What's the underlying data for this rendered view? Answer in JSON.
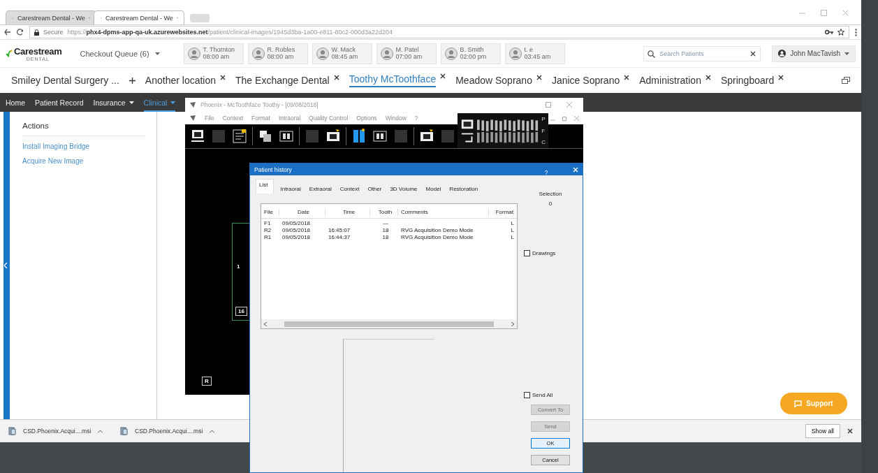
{
  "browser": {
    "tabs": [
      {
        "title": "Carestream Dental - We",
        "selected": false
      },
      {
        "title": "Carestream Dental - We",
        "selected": true
      }
    ],
    "secure_label": "Secure",
    "url": "https://**phx4-dpms-app-qa-uk.azurewebsites.net**/patient/clinical-images/1945d3ba-1a00-e811-80c2-000d3a22d204"
  },
  "header": {
    "logo": "Carestream",
    "logo_sub": "DENTAL",
    "queue": "Checkout Queue (6)",
    "appointments": [
      {
        "name": "T. Thornton",
        "time": "08:00 am"
      },
      {
        "name": "R. Robles",
        "time": "08:00 am"
      },
      {
        "name": "W. Mack",
        "time": "08:45 am"
      },
      {
        "name": "M. Patel",
        "time": "07:00 am"
      },
      {
        "name": "B. Smith",
        "time": "02:00 pm"
      },
      {
        "name": "t. e",
        "time": "03:45 am"
      }
    ],
    "search": {
      "placeholder": "Search Patients"
    },
    "user": "John MacTavish"
  },
  "location_tabs": [
    {
      "label": "Smiley Dental Surgery ...",
      "closable": false,
      "selected": false
    },
    {
      "label": "Another location",
      "closable": true,
      "selected": false
    },
    {
      "label": "The Exchange Dental",
      "closable": true,
      "selected": false
    },
    {
      "label": "Toothy McToothface",
      "closable": true,
      "selected": true
    },
    {
      "label": "Meadow Soprano",
      "closable": true,
      "selected": false
    },
    {
      "label": "Janice Soprano",
      "closable": true,
      "selected": false
    },
    {
      "label": "Administration",
      "closable": true,
      "selected": false
    },
    {
      "label": "Springboard",
      "closable": true,
      "selected": false
    }
  ],
  "nav": [
    {
      "label": "Home",
      "dropdown": false,
      "selected": false
    },
    {
      "label": "Patient Record",
      "dropdown": false,
      "selected": false
    },
    {
      "label": "Insurance",
      "dropdown": true,
      "selected": false
    },
    {
      "label": "Clinical",
      "dropdown": true,
      "selected": true
    }
  ],
  "actions": {
    "title": "Actions",
    "links": [
      "Install Imaging Bridge",
      "Acquire New Image"
    ]
  },
  "phoenix": {
    "title": "Phoenix - McToothface Toothy - [09/08/2018]",
    "menu": [
      "File",
      "Context",
      "Format",
      "Intraoral",
      "Quality Control",
      "Options",
      "Window",
      "?"
    ],
    "view_letters": [
      "P",
      "F",
      "C"
    ],
    "frame_labels": [
      "1",
      "16",
      "R"
    ]
  },
  "dialog": {
    "title": "Patient history",
    "help": "?",
    "tabs": [
      {
        "label": "List",
        "selected": true
      },
      {
        "label": "Intraoral",
        "selected": false
      },
      {
        "label": "Extraoral",
        "selected": false
      },
      {
        "label": "Context",
        "selected": false
      },
      {
        "label": "Other",
        "selected": false
      },
      {
        "label": "3D Volume",
        "selected": false
      },
      {
        "label": "Model",
        "selected": false
      },
      {
        "label": "Restoration",
        "selected": false
      }
    ],
    "columns": [
      "File",
      "Date",
      "Time",
      "Tooth",
      "Comments",
      "Format"
    ],
    "rows": [
      {
        "file": "F1",
        "date": "09/05/2018",
        "tooth": "—",
        "format": "L"
      },
      {
        "file": "R2",
        "date": "09/05/2018",
        "time": "16:45:07",
        "tooth": "18",
        "comments": "RVG Acquisition Demo Mode",
        "format": "L"
      },
      {
        "file": "R1",
        "date": "09/05/2018",
        "time": "16:44:37",
        "tooth": "18",
        "comments": "RVG Acquisition Demo Mode",
        "format": "L"
      }
    ],
    "selection_label": "Selection",
    "selection_count": "0",
    "drawings": {
      "label": "Drawings",
      "checked": false
    },
    "send_all": {
      "label": "Send All",
      "checked": false
    },
    "buttons": [
      {
        "label": "Convert To",
        "disabled": true,
        "default": false
      },
      {
        "label": "Send",
        "disabled": true,
        "default": false
      },
      {
        "label": "OK",
        "disabled": false,
        "default": true
      },
      {
        "label": "Cancel",
        "disabled": false,
        "default": false
      }
    ]
  },
  "downloads": [
    {
      "name": "CSD.Phoenix.Acqui....msi"
    },
    {
      "name": "CSD.Phoenix.Acqui....msi"
    }
  ],
  "show_all": "Show all",
  "support": "Support"
}
